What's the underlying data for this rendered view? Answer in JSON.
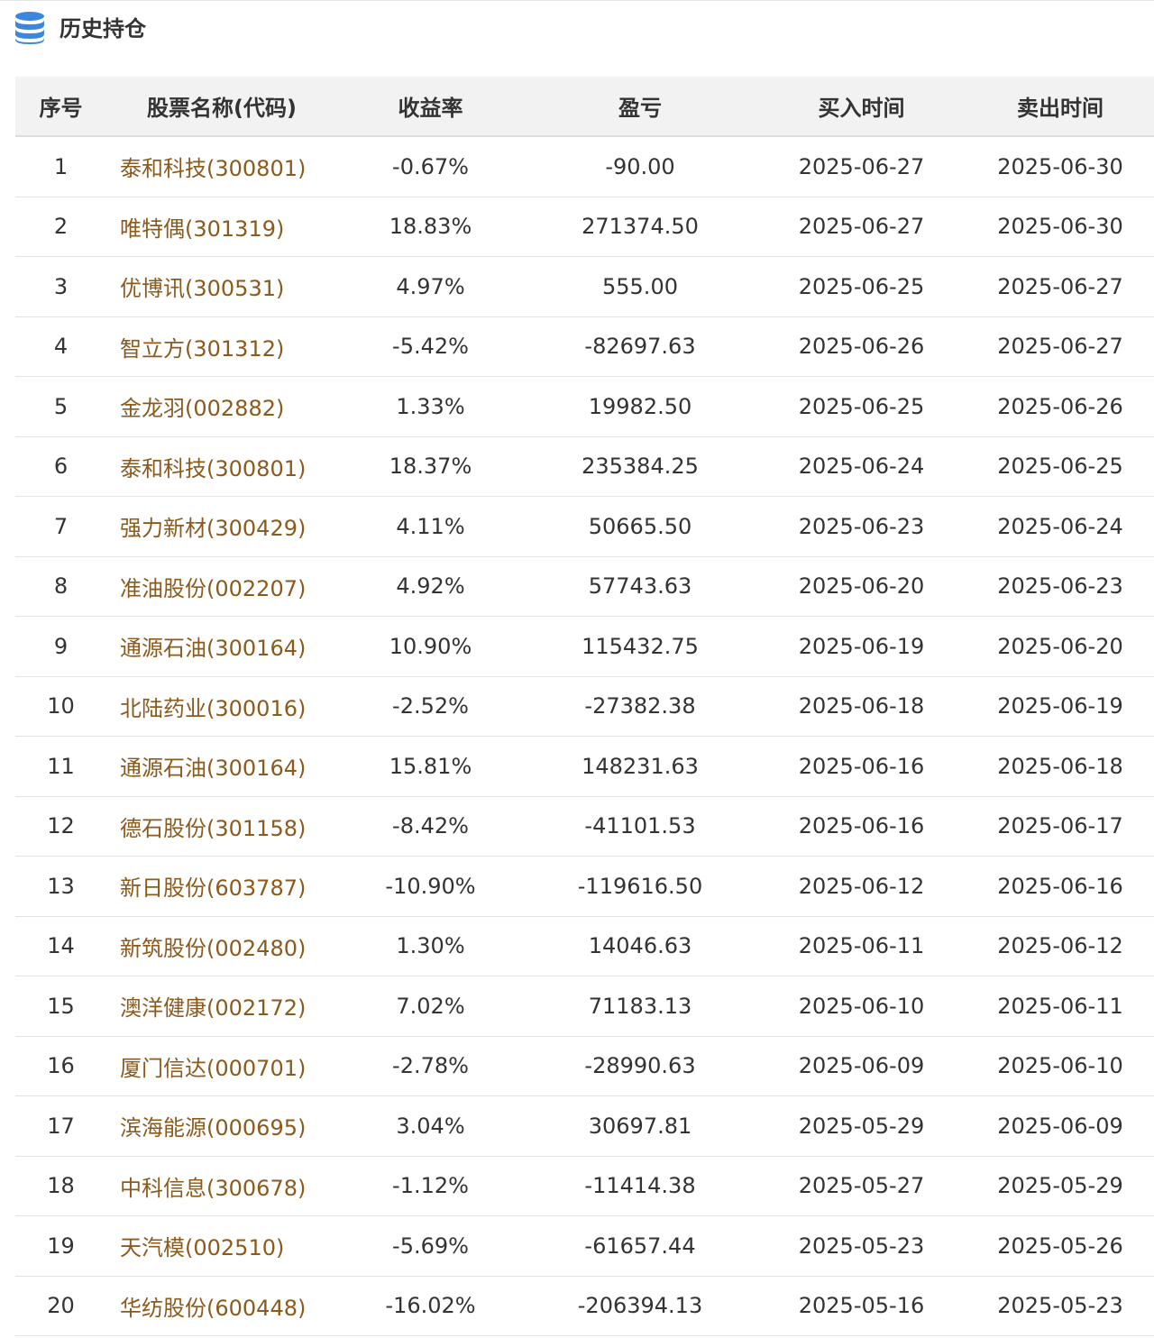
{
  "header": {
    "title": "历史持仓",
    "icon": "database-icon",
    "icon_color": "#3d86e0"
  },
  "colors": {
    "gain": "#e02020",
    "loss": "#2e8b1e",
    "stock_name": "#8b5a1c"
  },
  "table": {
    "columns": [
      "序号",
      "股票名称(代码)",
      "收益率",
      "盈亏",
      "买入时间",
      "卖出时间"
    ],
    "rows": [
      {
        "index": "1",
        "name": "泰和科技(300801)",
        "return": "-0.67%",
        "pnl": "-90.00",
        "buy": "2025-06-27",
        "sell": "2025-06-30",
        "trend": "down"
      },
      {
        "index": "2",
        "name": "唯特偶(301319)",
        "return": "18.83%",
        "pnl": "271374.50",
        "buy": "2025-06-27",
        "sell": "2025-06-30",
        "trend": "up"
      },
      {
        "index": "3",
        "name": "优博讯(300531)",
        "return": "4.97%",
        "pnl": "555.00",
        "buy": "2025-06-25",
        "sell": "2025-06-27",
        "trend": "up"
      },
      {
        "index": "4",
        "name": "智立方(301312)",
        "return": "-5.42%",
        "pnl": "-82697.63",
        "buy": "2025-06-26",
        "sell": "2025-06-27",
        "trend": "down"
      },
      {
        "index": "5",
        "name": "金龙羽(002882)",
        "return": "1.33%",
        "pnl": "19982.50",
        "buy": "2025-06-25",
        "sell": "2025-06-26",
        "trend": "up"
      },
      {
        "index": "6",
        "name": "泰和科技(300801)",
        "return": "18.37%",
        "pnl": "235384.25",
        "buy": "2025-06-24",
        "sell": "2025-06-25",
        "trend": "up"
      },
      {
        "index": "7",
        "name": "强力新材(300429)",
        "return": "4.11%",
        "pnl": "50665.50",
        "buy": "2025-06-23",
        "sell": "2025-06-24",
        "trend": "up"
      },
      {
        "index": "8",
        "name": "准油股份(002207)",
        "return": "4.92%",
        "pnl": "57743.63",
        "buy": "2025-06-20",
        "sell": "2025-06-23",
        "trend": "up"
      },
      {
        "index": "9",
        "name": "通源石油(300164)",
        "return": "10.90%",
        "pnl": "115432.75",
        "buy": "2025-06-19",
        "sell": "2025-06-20",
        "trend": "up"
      },
      {
        "index": "10",
        "name": "北陆药业(300016)",
        "return": "-2.52%",
        "pnl": "-27382.38",
        "buy": "2025-06-18",
        "sell": "2025-06-19",
        "trend": "down"
      },
      {
        "index": "11",
        "name": "通源石油(300164)",
        "return": "15.81%",
        "pnl": "148231.63",
        "buy": "2025-06-16",
        "sell": "2025-06-18",
        "trend": "up"
      },
      {
        "index": "12",
        "name": "德石股份(301158)",
        "return": "-8.42%",
        "pnl": "-41101.53",
        "buy": "2025-06-16",
        "sell": "2025-06-17",
        "trend": "down"
      },
      {
        "index": "13",
        "name": "新日股份(603787)",
        "return": "-10.90%",
        "pnl": "-119616.50",
        "buy": "2025-06-12",
        "sell": "2025-06-16",
        "trend": "down"
      },
      {
        "index": "14",
        "name": "新筑股份(002480)",
        "return": "1.30%",
        "pnl": "14046.63",
        "buy": "2025-06-11",
        "sell": "2025-06-12",
        "trend": "up"
      },
      {
        "index": "15",
        "name": "澳洋健康(002172)",
        "return": "7.02%",
        "pnl": "71183.13",
        "buy": "2025-06-10",
        "sell": "2025-06-11",
        "trend": "up"
      },
      {
        "index": "16",
        "name": "厦门信达(000701)",
        "return": "-2.78%",
        "pnl": "-28990.63",
        "buy": "2025-06-09",
        "sell": "2025-06-10",
        "trend": "down"
      },
      {
        "index": "17",
        "name": "滨海能源(000695)",
        "return": "3.04%",
        "pnl": "30697.81",
        "buy": "2025-05-29",
        "sell": "2025-06-09",
        "trend": "up"
      },
      {
        "index": "18",
        "name": "中科信息(300678)",
        "return": "-1.12%",
        "pnl": "-11414.38",
        "buy": "2025-05-27",
        "sell": "2025-05-29",
        "trend": "down"
      },
      {
        "index": "19",
        "name": "天汽模(002510)",
        "return": "-5.69%",
        "pnl": "-61657.44",
        "buy": "2025-05-23",
        "sell": "2025-05-26",
        "trend": "down"
      },
      {
        "index": "20",
        "name": "华纺股份(600448)",
        "return": "-16.02%",
        "pnl": "-206394.13",
        "buy": "2025-05-16",
        "sell": "2025-05-23",
        "trend": "down"
      }
    ]
  }
}
